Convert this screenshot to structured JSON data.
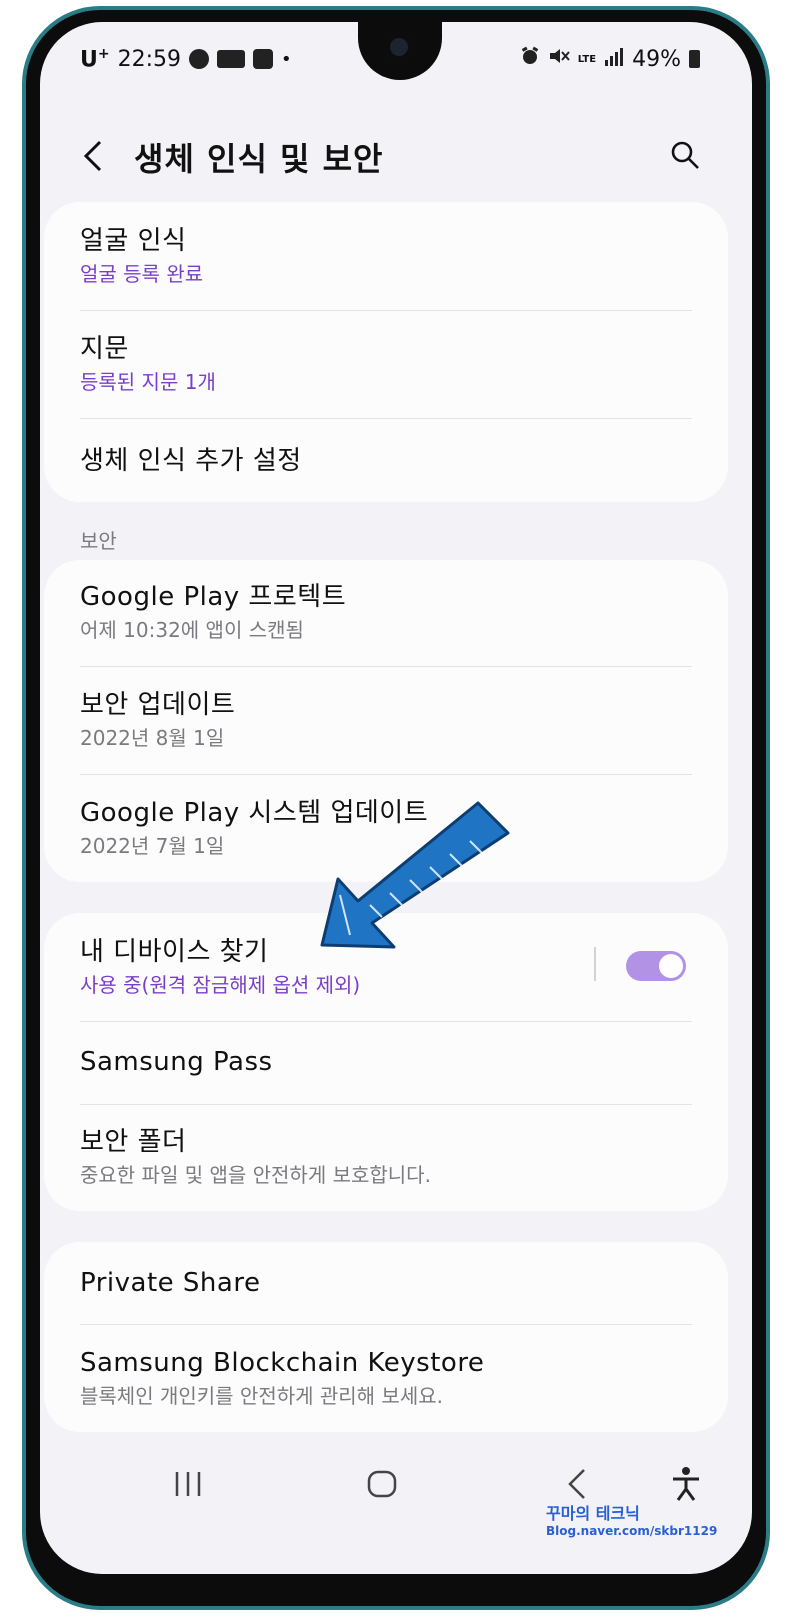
{
  "status_bar": {
    "carrier": "U",
    "carrier_plus": "+",
    "time": "22:59",
    "dot": "•",
    "lte": "LTE",
    "battery": "49%"
  },
  "header": {
    "title": "생체 인식 및 보안"
  },
  "biometrics": [
    {
      "title": "얼굴 인식",
      "subtitle": "얼굴 등록 완료"
    },
    {
      "title": "지문",
      "subtitle": "등록된 지문 1개"
    },
    {
      "title": "생체 인식 추가 설정"
    }
  ],
  "section_security": "보안",
  "security": [
    {
      "title": "Google Play 프로텍트",
      "subtitle": "어제 10:32에 앱이 스캔됨"
    },
    {
      "title": "보안 업데이트",
      "subtitle": "2022년 8월 1일"
    },
    {
      "title": "Google Play 시스템 업데이트",
      "subtitle": "2022년 7월 1일"
    }
  ],
  "device": [
    {
      "title": "내 디바이스 찾기",
      "subtitle": "사용 중(원격 잠금해제 옵션 제외)",
      "toggle_on": true
    },
    {
      "title": "Samsung Pass"
    },
    {
      "title": "보안 폴더",
      "subtitle": "중요한 파일 및 앱을 안전하게 보호합니다."
    }
  ],
  "other": [
    {
      "title": "Private Share"
    },
    {
      "title": "Samsung Blockchain Keystore",
      "subtitle": "블록체인 개인키를 안전하게 관리해 보세요."
    }
  ],
  "watermark": {
    "title": "꾸마의 테크닉",
    "url": "Blog.naver.com/skbr1129"
  },
  "colors": {
    "accent": "#7a3fc9",
    "toggle": "#b292e4",
    "frame": "#2a7d86",
    "arrow": "#1f74c4"
  }
}
